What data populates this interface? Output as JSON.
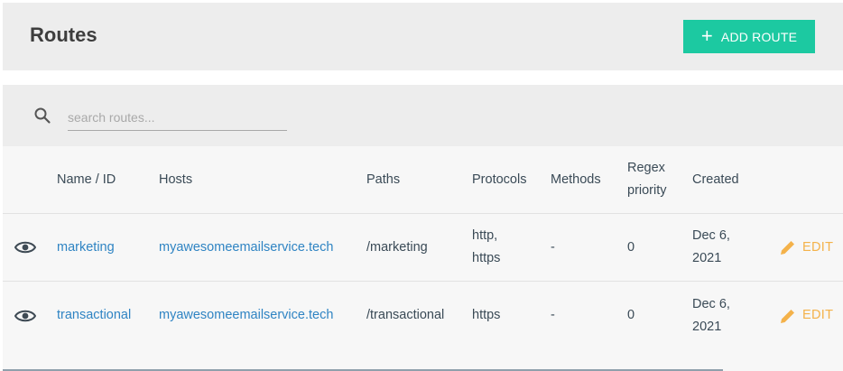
{
  "header": {
    "title": "Routes",
    "add_button_label": "ADD ROUTE"
  },
  "search": {
    "placeholder": "search routes..."
  },
  "table": {
    "columns": [
      "Name / ID",
      "Hosts",
      "Paths",
      "Protocols",
      "Methods",
      "Regex priority",
      "Created"
    ],
    "regex_priority_lines": [
      "Regex",
      "priority"
    ],
    "rows": [
      {
        "name": "marketing",
        "host": "myawesomeemailservice.tech",
        "path": "/marketing",
        "protocols": [
          "http,",
          "https"
        ],
        "methods": "-",
        "regex_priority": "0",
        "created": [
          "Dec 6,",
          "2021"
        ],
        "edit_label": "EDIT"
      },
      {
        "name": "transactional",
        "host": "myawesomeemailservice.tech",
        "path": "/transactional",
        "protocols": [
          "https"
        ],
        "methods": "-",
        "regex_priority": "0",
        "created": [
          "Dec 6,",
          "2021"
        ],
        "edit_label": "EDIT"
      }
    ]
  },
  "colors": {
    "accent": "#1cc9a1",
    "link": "#2f84c3",
    "edit": "#f4b24a"
  },
  "icons": {
    "search": "search-icon",
    "view": "eye-icon",
    "edit": "pencil-icon",
    "add": "plus-icon"
  }
}
